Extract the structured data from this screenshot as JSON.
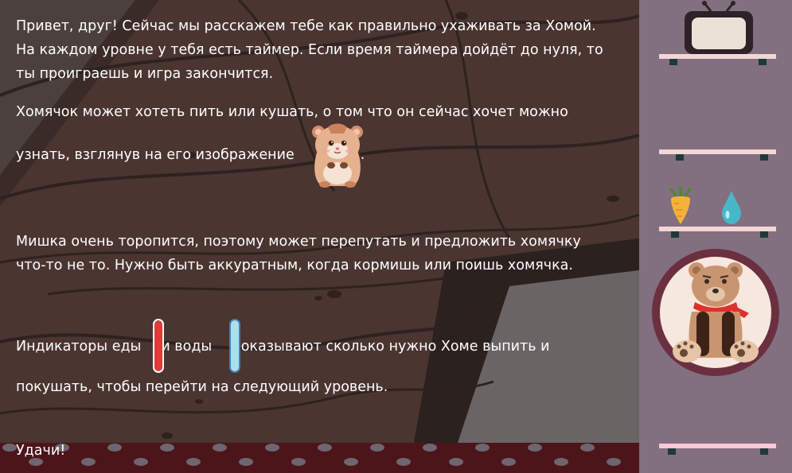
{
  "instructions": {
    "para1_line1": "Привет, друг! Сейчас мы расскажем тебе как правильно ухаживать за Хомой.",
    "para1_line2": "На каждом уровне у тебя есть таймер. Если время таймера дойдёт до нуля, то",
    "para1_line3": "ты проиграешь и игра закончится.",
    "para2_line1": "Хомячок может хотеть пить или кушать, о том что он сейчас хочет можно",
    "para2_line2": "узнать, взглянув на его изображение",
    "para2_period": ".",
    "para3_line1": "Мишка очень торопится, поэтому может перепутать и предложить хомячку",
    "para3_line2": "что-то не то. Нужно быть аккуратным, когда кормишь или поишь хомячка.",
    "para4_before_food": "Индикаторы еды",
    "para4_between": "и воды",
    "para4_after_water": "показывают сколько нужно Хоме выпить и",
    "para4_line2": "покушать, чтобы перейти на следующий уровень.",
    "closing": "Удачи!"
  },
  "colors": {
    "wood": "#4a3530",
    "wood_dark": "#2f2422",
    "floor": "#4b1519",
    "panel": "#826f80",
    "shelf": "#f3d6d6",
    "food_indicator": "#e23a3a",
    "water_indicator": "#a8e0f0",
    "bear_frame": "#6b3040"
  },
  "icons": {
    "hamster": "hamster-icon",
    "food_indicator": "food-indicator-icon",
    "water_indicator": "water-indicator-icon",
    "tv": "tv-icon",
    "carrot": "carrot-icon",
    "water_drop": "water-drop-icon",
    "bear": "bear-icon"
  }
}
